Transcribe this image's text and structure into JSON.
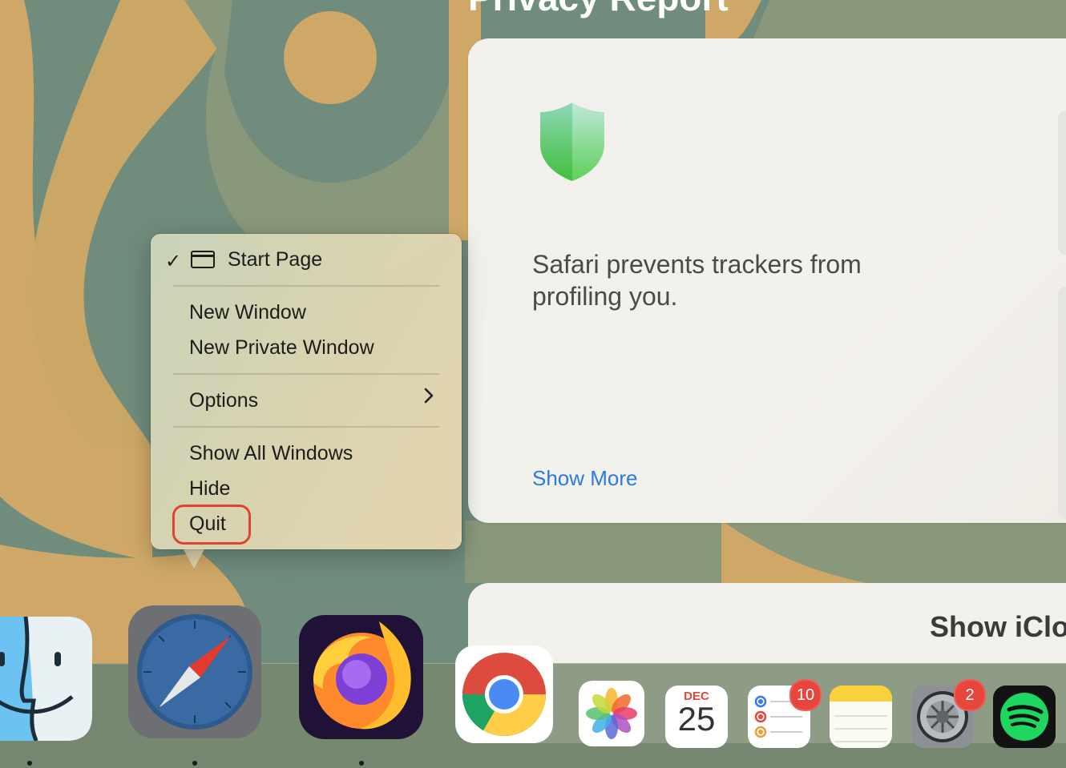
{
  "page": {
    "title": "Privacy Report"
  },
  "privacy_card": {
    "icon": "shield-icon",
    "text": "Safari prevents trackers from profiling you.",
    "show_more": "Show More"
  },
  "icloud_card": {
    "title": "Show iClo"
  },
  "context_menu": {
    "items": [
      {
        "label": "Start Page",
        "checked": true,
        "icon": "window-icon"
      },
      {
        "label": "New Window"
      },
      {
        "label": "New Private Window"
      },
      {
        "label": "Options",
        "submenu": true
      },
      {
        "label": "Show All Windows"
      },
      {
        "label": "Hide"
      },
      {
        "label": "Quit",
        "highlighted": true
      }
    ],
    "highlight_color": "#e0432f"
  },
  "dock": {
    "apps": [
      {
        "name": "Finder",
        "icon": "finder-icon",
        "running": true
      },
      {
        "name": "Safari",
        "icon": "safari-icon",
        "running": true
      },
      {
        "name": "Firefox",
        "icon": "firefox-icon",
        "running": true
      },
      {
        "name": "Google Chrome",
        "icon": "chrome-icon"
      },
      {
        "name": "Photos",
        "icon": "photos-icon"
      },
      {
        "name": "Calendar",
        "icon": "calendar-icon",
        "month": "DEC",
        "day": "25"
      },
      {
        "name": "Reminders",
        "icon": "reminders-icon",
        "badge": "10"
      },
      {
        "name": "Notes",
        "icon": "notes-icon"
      },
      {
        "name": "System Settings",
        "icon": "settings-icon",
        "badge": "2"
      },
      {
        "name": "Spotify",
        "icon": "spotify-icon"
      }
    ]
  },
  "colors": {
    "link": "#2a7ae4",
    "badge": "#e8453c",
    "shield_top": "#bfe7d8",
    "shield_bottom": "#5ed05a"
  }
}
